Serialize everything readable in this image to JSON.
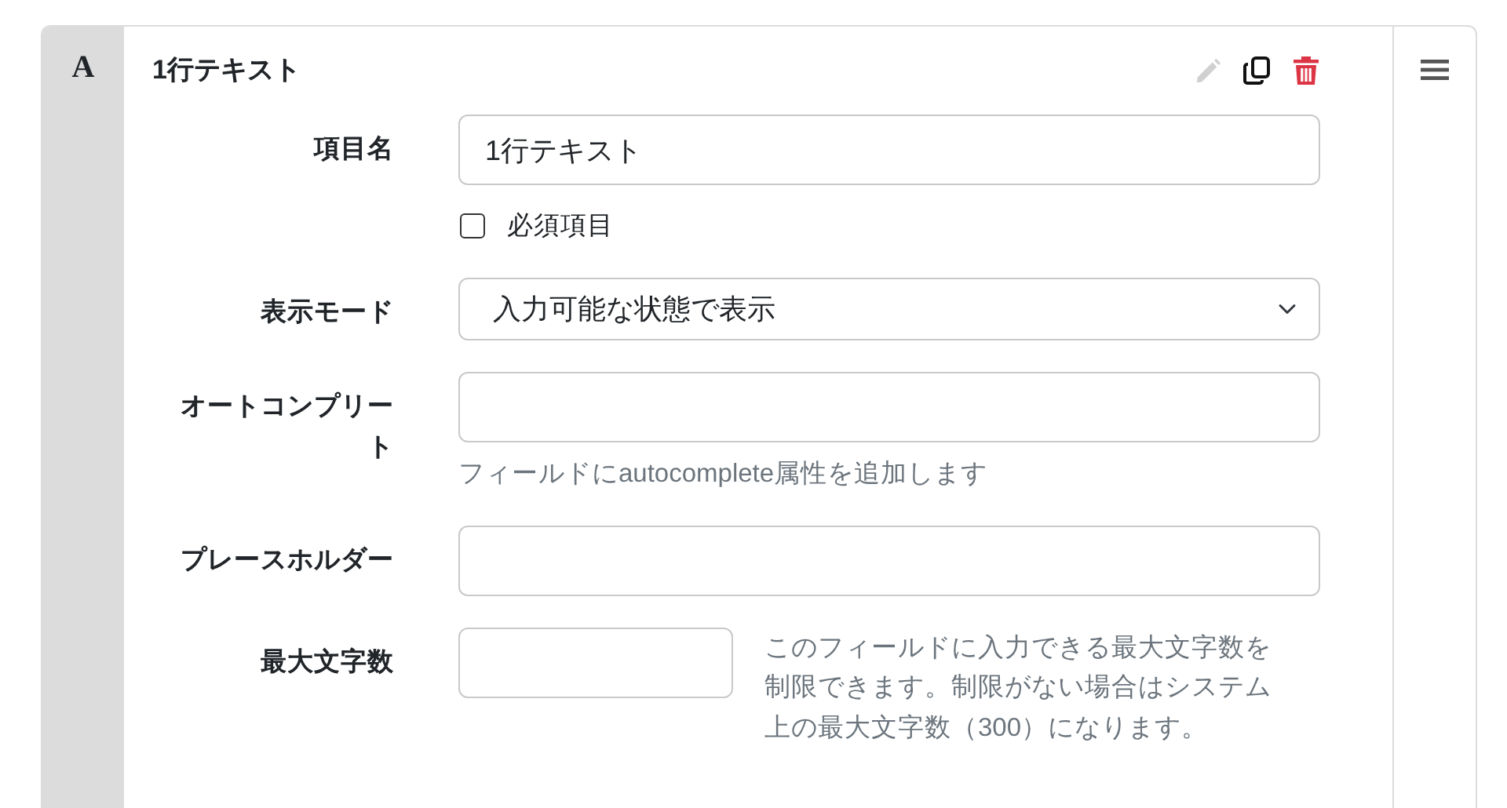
{
  "card": {
    "type_icon": "A",
    "title": "1行テキスト",
    "actions": [
      {
        "kind": "edit",
        "disabled": true
      },
      {
        "kind": "copy",
        "disabled": false
      },
      {
        "kind": "delete",
        "disabled": false
      }
    ],
    "fields": [
      {
        "kind": "text",
        "label": "項目名",
        "value": "1行テキスト"
      },
      {
        "kind": "checkbox",
        "label": "必須項目",
        "checked": false
      },
      {
        "kind": "select",
        "label": "表示モード",
        "value": "入力可能な状態で表示"
      },
      {
        "kind": "text",
        "label": "オートコンプリート",
        "help": "フィールドにautocomplete属性を追加します"
      },
      {
        "kind": "text",
        "label": "プレースホルダー"
      },
      {
        "kind": "short",
        "label": "最大文字数",
        "help": "このフィールドに入力できる最大文字数を制限できます。制限がない場合はシステム上の最大文字数（300）になります。"
      }
    ]
  }
}
